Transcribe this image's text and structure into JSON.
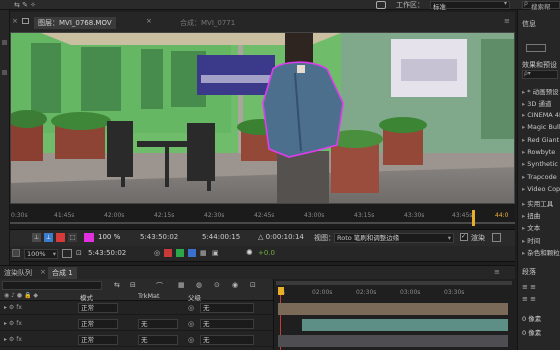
{
  "menubar": {
    "workspace_label": "工作区：",
    "workspace_value": "标准",
    "search_placeholder": "搜索帮"
  },
  "viewer": {
    "tabs": [
      {
        "label": "图层：MVI_0768.MOV"
      },
      {
        "label": "合成：MVI_0771"
      }
    ],
    "ruler_ticks": [
      "0:30s",
      "41:45s",
      "42:00s",
      "42:15s",
      "42:30s",
      "42:45s",
      "43:00s",
      "43:15s",
      "43:30s",
      "43:45s",
      "44:0"
    ],
    "controls": {
      "percent": "100 %",
      "time_in": "5:43:50:02",
      "time_out": "5:44:00:15",
      "duration": "△ 0:00:10:14",
      "view_label": "视图：",
      "view_value": "Roto 笔刷和调整边缘",
      "render_label": "渲染"
    },
    "status": {
      "zoom": "100%",
      "timecode": "5:43:50:02",
      "exposure": "+0.0"
    }
  },
  "right_panel": {
    "header": "信息",
    "effects_header": "效果和预设",
    "search_placeholder": "ρ▾",
    "items": [
      "* 动画预设",
      "3D 通道",
      "CINEMA 4D",
      "Magic Bullet",
      "Red Giant",
      "Rowbyte",
      "Synthetic",
      "Trapcode",
      "Video Copilot",
      "实用工具",
      "扭曲",
      "文本",
      "时间",
      "杂色和颗粒"
    ],
    "bottom_header": "段落",
    "bottom_values": [
      "0 像素",
      "0 像素"
    ]
  },
  "timeline": {
    "tabs": [
      {
        "label": "渲染队列"
      },
      {
        "label": "合成 1"
      }
    ],
    "columns": {
      "mode": "模式",
      "trkmat": "TrkMat",
      "parent": "父级"
    },
    "ruler_ticks": [
      "0s",
      "02:00s",
      "02:30s",
      "03:00s",
      "03:30s"
    ],
    "rows": [
      {
        "mode": "正常",
        "trkmat": "",
        "parent": "无"
      },
      {
        "mode": "正常",
        "trkmat": "无",
        "parent": "无"
      },
      {
        "mode": "正常",
        "trkmat": "无",
        "parent": "无"
      }
    ]
  }
}
